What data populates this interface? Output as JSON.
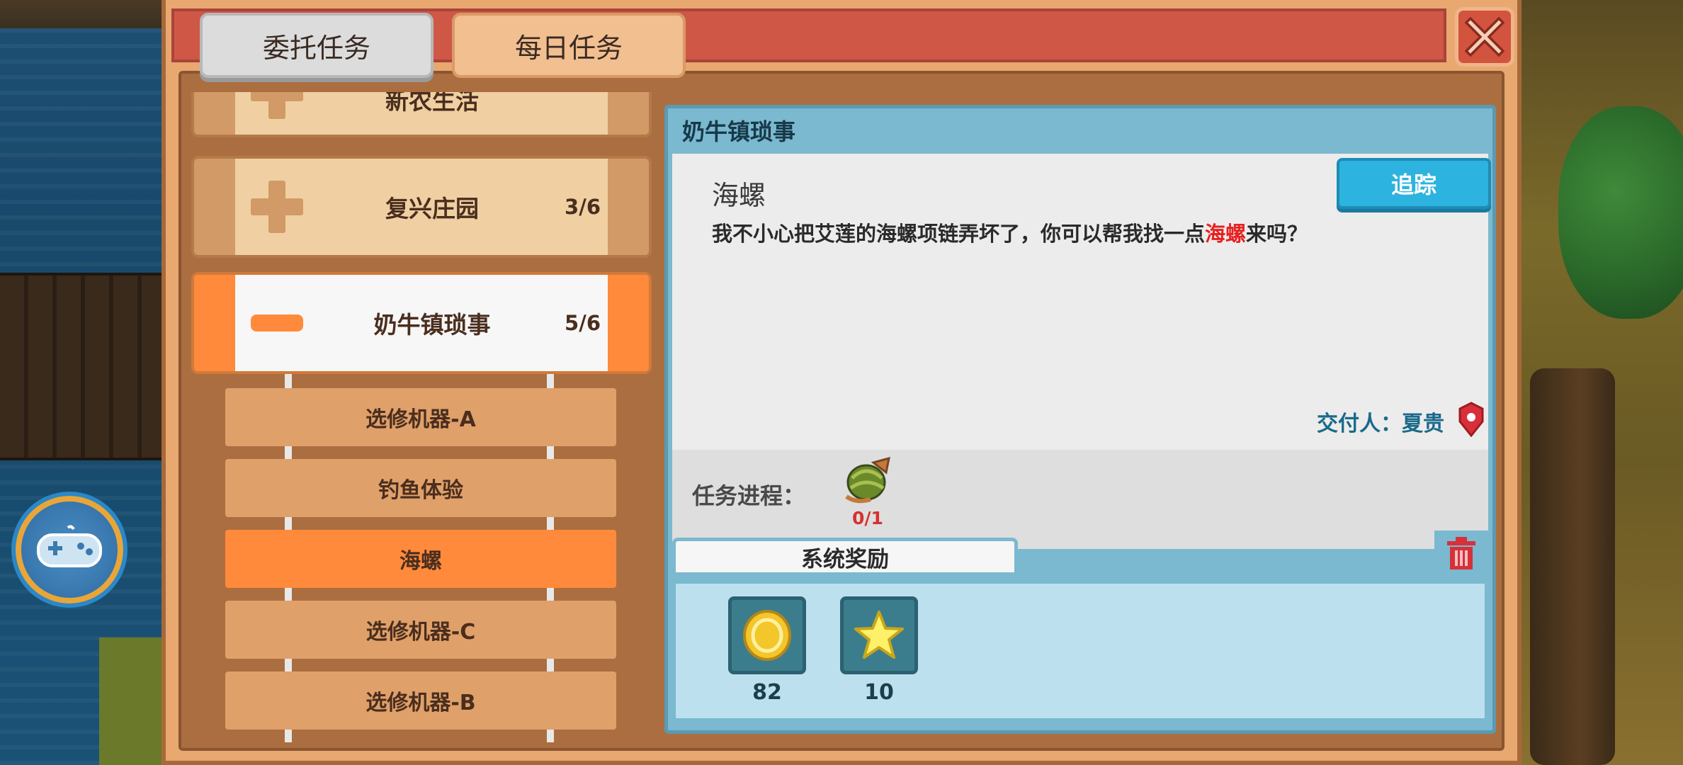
{
  "tabs": {
    "commission": "委托任务",
    "daily": "每日任务"
  },
  "categories": [
    {
      "name": "新农生活",
      "count": ""
    },
    {
      "name": "复兴庄园",
      "count": "3/6"
    },
    {
      "name": "奶牛镇琐事",
      "count": "5/6"
    }
  ],
  "sub_items": [
    {
      "label": "选修机器-A"
    },
    {
      "label": "钓鱼体验"
    },
    {
      "label": "海螺"
    },
    {
      "label": "选修机器-C"
    },
    {
      "label": "选修机器-B"
    }
  ],
  "detail": {
    "title": "奶牛镇琐事",
    "task_name": "海螺",
    "desc_prefix": "我不小心把艾莲的海螺项链弄坏了，你可以帮我找一点",
    "desc_highlight": "海螺",
    "desc_suffix": "来吗？",
    "track_label": "追踪",
    "giver": "交付人：夏贵",
    "progress_label": "任务进程：",
    "progress_count": "0/1",
    "reward_tab": "系统奖励",
    "rewards": [
      {
        "icon": "gold-coin-icon",
        "count": "82"
      },
      {
        "icon": "star-icon",
        "count": "10"
      }
    ]
  },
  "colors": {
    "header_red": "#cf5746",
    "accent_orange": "#ff8a3c",
    "detail_blue": "#7ab9cf",
    "track_blue": "#2db3df",
    "highlight_red": "#e82020"
  }
}
